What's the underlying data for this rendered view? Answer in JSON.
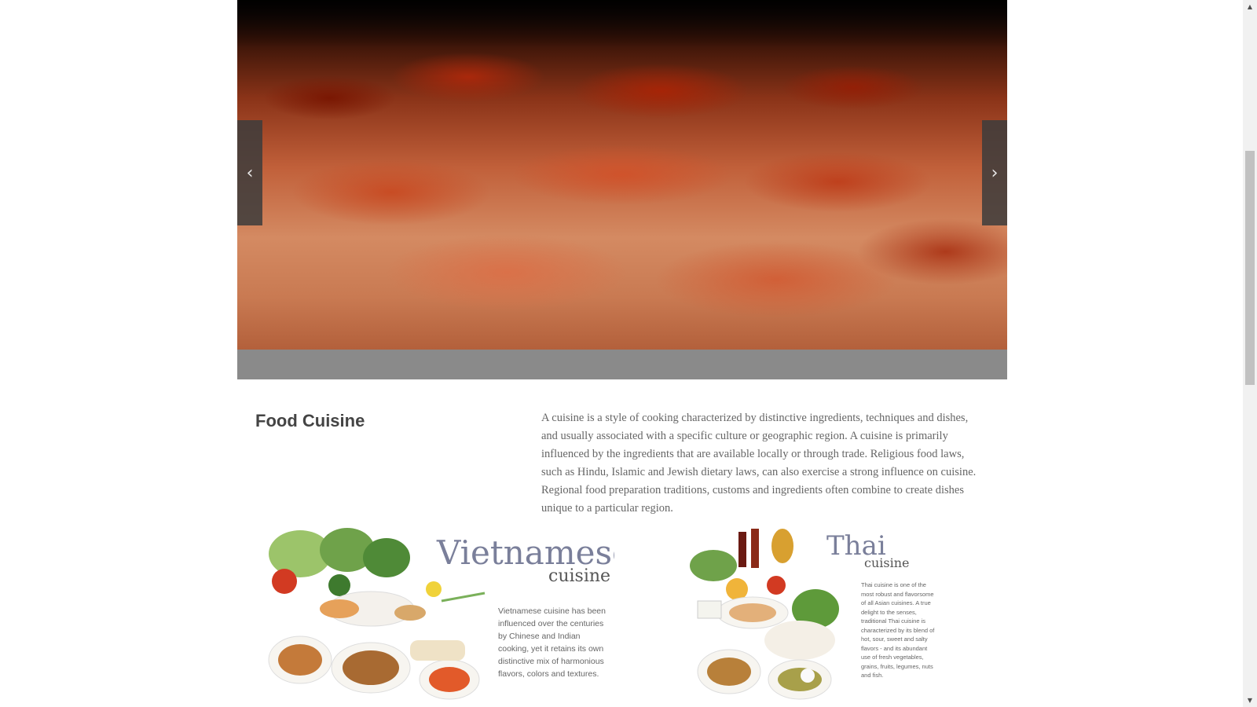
{
  "slider": {
    "prev_glyph": "‹",
    "next_glyph": "›",
    "prev_icon": "chevron-left-icon",
    "next_icon": "chevron-right-icon",
    "image_subject": "pepperoni pizza close-up"
  },
  "section": {
    "title": "Food Cuisine",
    "text": "A cuisine is a style of cooking characterized by distinctive ingredients, techniques and dishes, and usually associated with a specific culture or geographic region. A cuisine is primarily influenced by the ingredients that are available locally or through trade. Religious food laws, such as Hindu, Islamic and Jewish dietary laws, can also exercise a strong influence on cuisine. Regional food preparation traditions, customs and ingredients often combine to create dishes unique to a particular region."
  },
  "cards": {
    "vietnamese": {
      "name": "Vietnamese",
      "sub": "cuisine",
      "desc": "Vietnamese cuisine has been influenced over the centuries by Chinese and Indian cooking, yet it retains its own distinctive mix of harmonious flavors, colors and textures."
    },
    "thai": {
      "name": "Thai",
      "sub": "cuisine",
      "desc": "Thai cuisine is one of the most robust and flavorsome of all Asian cuisines. A true delight to the senses, traditional Thai cuisine is characterized by its blend of hot, sour, sweet and salty flavors - and its abundant use of fresh vegetables, grains, fruits, legumes, nuts and fish."
    }
  },
  "scrollbar": {
    "up_glyph": "▲",
    "down_glyph": "▼",
    "position": 0.33
  },
  "colors": {
    "caption_bar": "#8a8a8a",
    "title": "#444444",
    "body_text": "#666666",
    "card_name": "#7a7f9a"
  }
}
